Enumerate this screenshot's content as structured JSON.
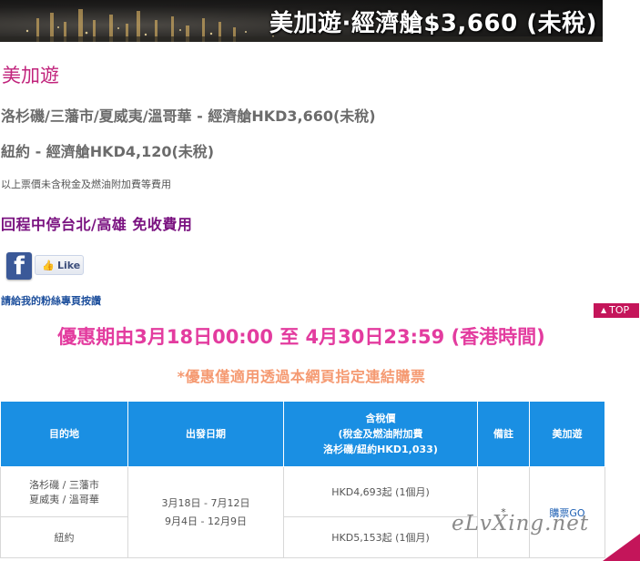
{
  "banner": {
    "title": "美加遊·經濟艙$3,660 (未稅)"
  },
  "heading": "美加遊",
  "routes": [
    "洛杉磯/三藩市/夏威夷/溫哥華 - 經濟艙HKD3,660(未稅)",
    "紐約 - 經濟艙HKD4,120(未稅)"
  ],
  "note": "以上票價未含稅金及燃油附加費等費用",
  "stopover": "回程中停台北/高雄 免收費用",
  "facebook": {
    "like_label": "Like",
    "fan_link": "請給我的粉絲專頁按讚"
  },
  "top_button": "TOP",
  "promo": {
    "period": "優惠期由3月18日00:00 至 4月30日23:59 (香港時間)",
    "note": "*優惠僅適用透過本網頁指定連結購票"
  },
  "table": {
    "headers": {
      "destination": "目的地",
      "dates": "出發日期",
      "price_line1": "含稅價",
      "price_line2": "(稅金及燃油附加費",
      "price_line3": "洛杉磯/紐約HKD1,033)",
      "remarks": "備註",
      "airline": "美加遊"
    },
    "rows": [
      {
        "dest_line1": "洛杉磯 / 三藩市",
        "dest_line2": "夏威夷 / 溫哥華",
        "price": "HKD4,693起 (1個月)"
      },
      {
        "dest_line1": "紐約",
        "price": "HKD5,153起 (1個月)"
      }
    ],
    "dates_line1": "3月18日 - 7月12日",
    "dates_line2": "9月4日 - 12月9日",
    "remark": "*",
    "buy_link": "購票GO"
  },
  "watermark": "eLvXing.net",
  "colors": {
    "accent": "#c1247c",
    "table_header": "#1a8fe3",
    "promo": "#e33c9f",
    "promo_note": "#f59a72",
    "top_button": "#c4155a"
  }
}
